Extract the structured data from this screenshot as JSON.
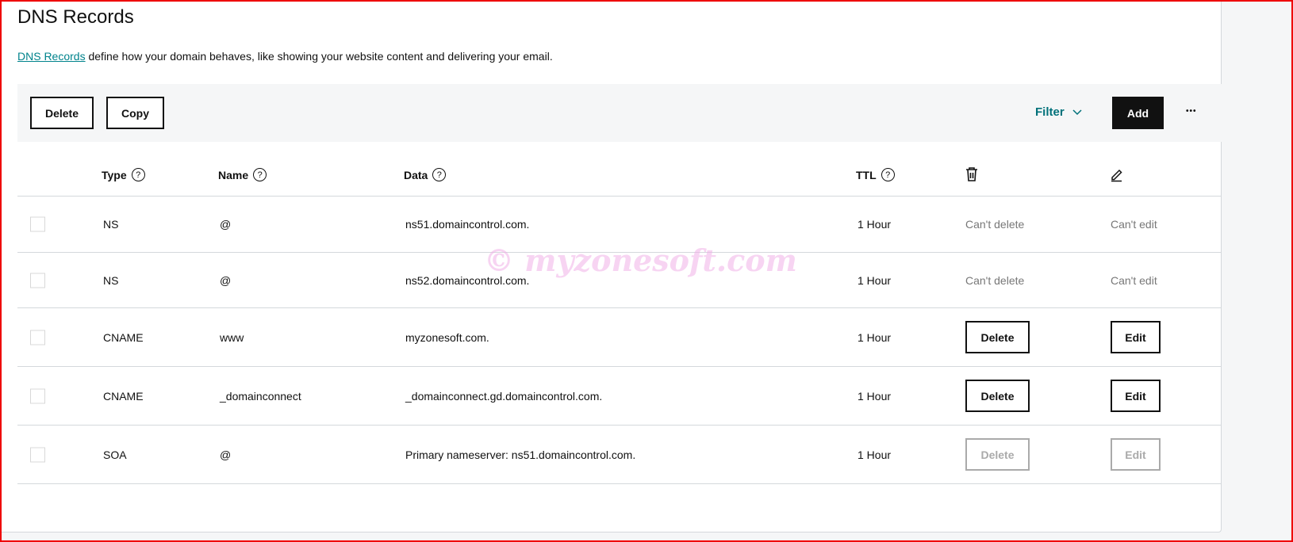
{
  "title": "DNS Records",
  "description": {
    "link": "DNS Records",
    "text": " define how your domain behaves, like showing your website content and delivering your email."
  },
  "toolbar": {
    "delete": "Delete",
    "copy": "Copy",
    "filter": "Filter",
    "add": "Add",
    "more": "•••"
  },
  "columns": {
    "type": "Type",
    "name": "Name",
    "data": "Data",
    "ttl": "TTL",
    "help": "?"
  },
  "rows": [
    {
      "type": "NS",
      "name": "@",
      "data": "ns51.domaincontrol.com.",
      "ttl": "1 Hour",
      "delete": "Can't delete",
      "edit": "Can't edit",
      "mode": "text"
    },
    {
      "type": "NS",
      "name": "@",
      "data": "ns52.domaincontrol.com.",
      "ttl": "1 Hour",
      "delete": "Can't delete",
      "edit": "Can't edit",
      "mode": "text"
    },
    {
      "type": "CNAME",
      "name": "www",
      "data": "myzonesoft.com.",
      "ttl": "1 Hour",
      "delete": "Delete",
      "edit": "Edit",
      "mode": "button"
    },
    {
      "type": "CNAME",
      "name": "_domainconnect",
      "data": "_domainconnect.gd.domaincontrol.com.",
      "ttl": "1 Hour",
      "delete": "Delete",
      "edit": "Edit",
      "mode": "button"
    },
    {
      "type": "SOA",
      "name": "@",
      "data": "Primary nameserver: ns51.domaincontrol.com.",
      "ttl": "1 Hour",
      "delete": "Delete",
      "edit": "Edit",
      "mode": "disabled"
    }
  ],
  "watermark": "© myzonesoft.com",
  "colors": {
    "accent": "#00838c",
    "frame": "#e00000"
  }
}
